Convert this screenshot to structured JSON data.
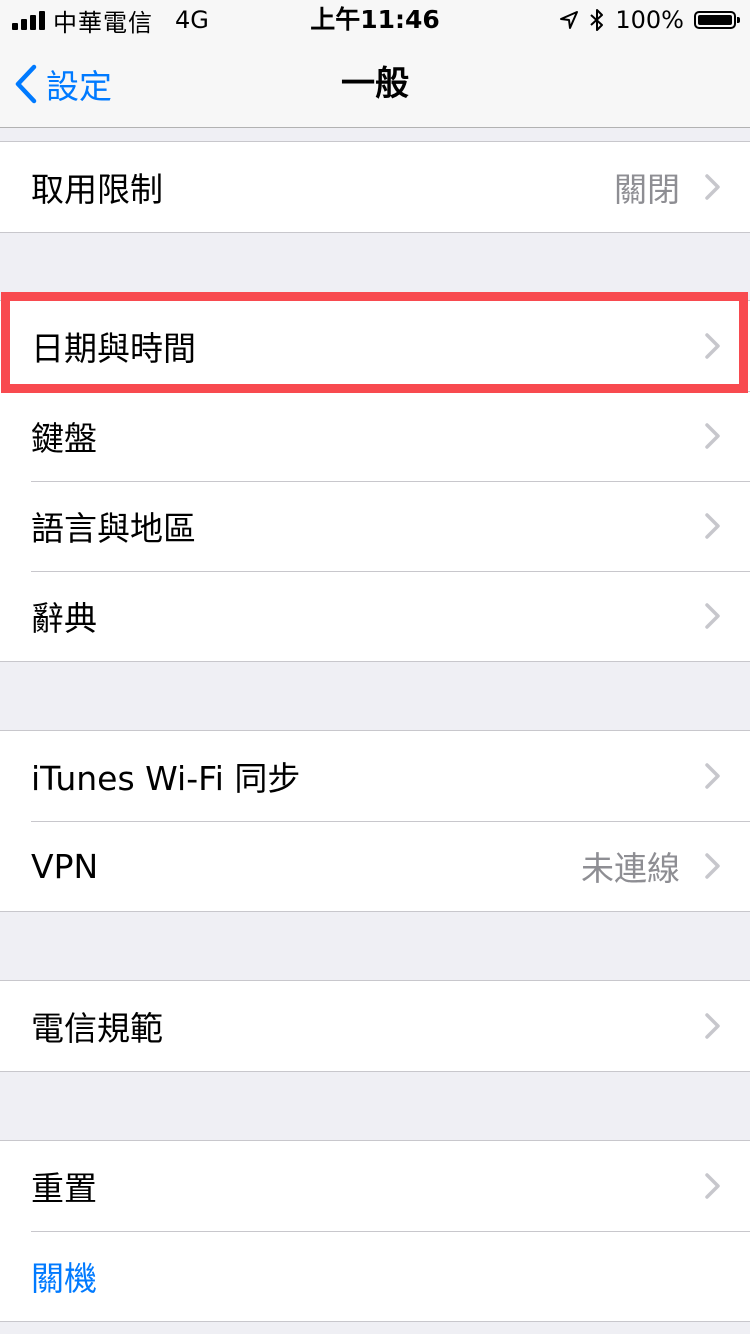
{
  "status_bar": {
    "carrier": "中華電信",
    "network": "4G",
    "time": "上午11:46",
    "battery_percent": "100%",
    "battery_level": 1.0,
    "signal_bars": 4
  },
  "nav": {
    "back_label": "設定",
    "title": "一般"
  },
  "groups": {
    "restrictions": {
      "label": "取用限制",
      "detail": "關閉"
    },
    "datetime": {
      "label": "日期與時間"
    },
    "keyboard": {
      "label": "鍵盤"
    },
    "language": {
      "label": "語言與地區"
    },
    "dictionary": {
      "label": "辭典"
    },
    "itunes": {
      "label": "iTunes Wi-Fi 同步"
    },
    "vpn": {
      "label": "VPN",
      "detail": "未連線"
    },
    "regulatory": {
      "label": "電信規範"
    },
    "reset": {
      "label": "重置"
    },
    "shutdown": {
      "label": "關機"
    }
  },
  "colors": {
    "accent": "#007aff",
    "highlight": "#f84a4f",
    "background": "#efeff4",
    "detail_text": "#8e8e93"
  },
  "icons": {
    "back": "chevron-left-icon",
    "disclosure": "chevron-right-icon",
    "location": "location-arrow-icon",
    "bluetooth": "bluetooth-icon",
    "battery": "battery-icon",
    "signal": "signal-bars-icon"
  }
}
